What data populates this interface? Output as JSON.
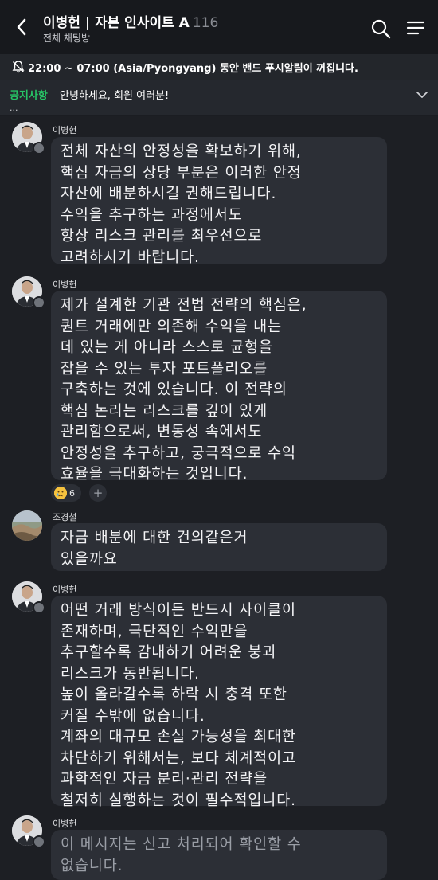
{
  "header": {
    "name": "이병헌 | 자본 인사이트 A",
    "member_count": "116",
    "subtitle": "전체 채팅방"
  },
  "notice": {
    "text": "22:00 ~ 07:00 (Asia/Pyongyang) 동안 밴드 푸시알림이 꺼집니다."
  },
  "announcement": {
    "label": "공지사항",
    "text": "안녕하세요, 회원 여러분!",
    "more": "..."
  },
  "messages": [
    {
      "sender": "이병헌",
      "text": "전체 자산의 안정성을 확보하기 위해,\n핵심 자금의 상당 부분은 이러한 안정\n자산에 배분하시길 권해드립니다.\n수익을 추구하는 과정에서도\n항상 리스크 관리를 최우선으로\n고려하시기 바랍니다."
    },
    {
      "sender": "이병헌",
      "text": "제가 설계한 기관 전법 전략의 핵심은,\n퀀트 거래에만 의존해 수익을 내는\n데 있는 게 아니라 스스로 균형을\n잡을 수 있는 투자 포트폴리오를\n구축하는 것에 있습니다. 이 전략의\n핵심 논리는 리스크를 깊이 있게\n관리함으로써, 변동성 속에서도\n안정성을 추구하고, 궁극적으로 수익\n효율을 극대화하는 것입니다.",
      "reaction_count": "6",
      "add_reaction": "+"
    },
    {
      "sender": "조경철",
      "text": "자금 배분에 대한 건의같은거\n있을까요"
    },
    {
      "sender": "이병헌",
      "text": "어떤 거래 방식이든 반드시 사이클이\n존재하며, 극단적인 수익만을\n추구할수록 감내하기 어려운 붕괴\n리스크가 동반됩니다.\n높이 올라갈수록 하락 시 충격 또한\n커질 수밖에 없습니다.\n계좌의 대규모 손실 가능성을 최대한\n차단하기 위해서는, 보다 체계적이고\n과학적인 자금 분리·관리 전략을\n철저히 실행하는 것이 필수적입니다."
    },
    {
      "sender": "이병헌",
      "text": "이 메시지는 신고 처리되어 확인할 수\n없습니다."
    }
  ]
}
